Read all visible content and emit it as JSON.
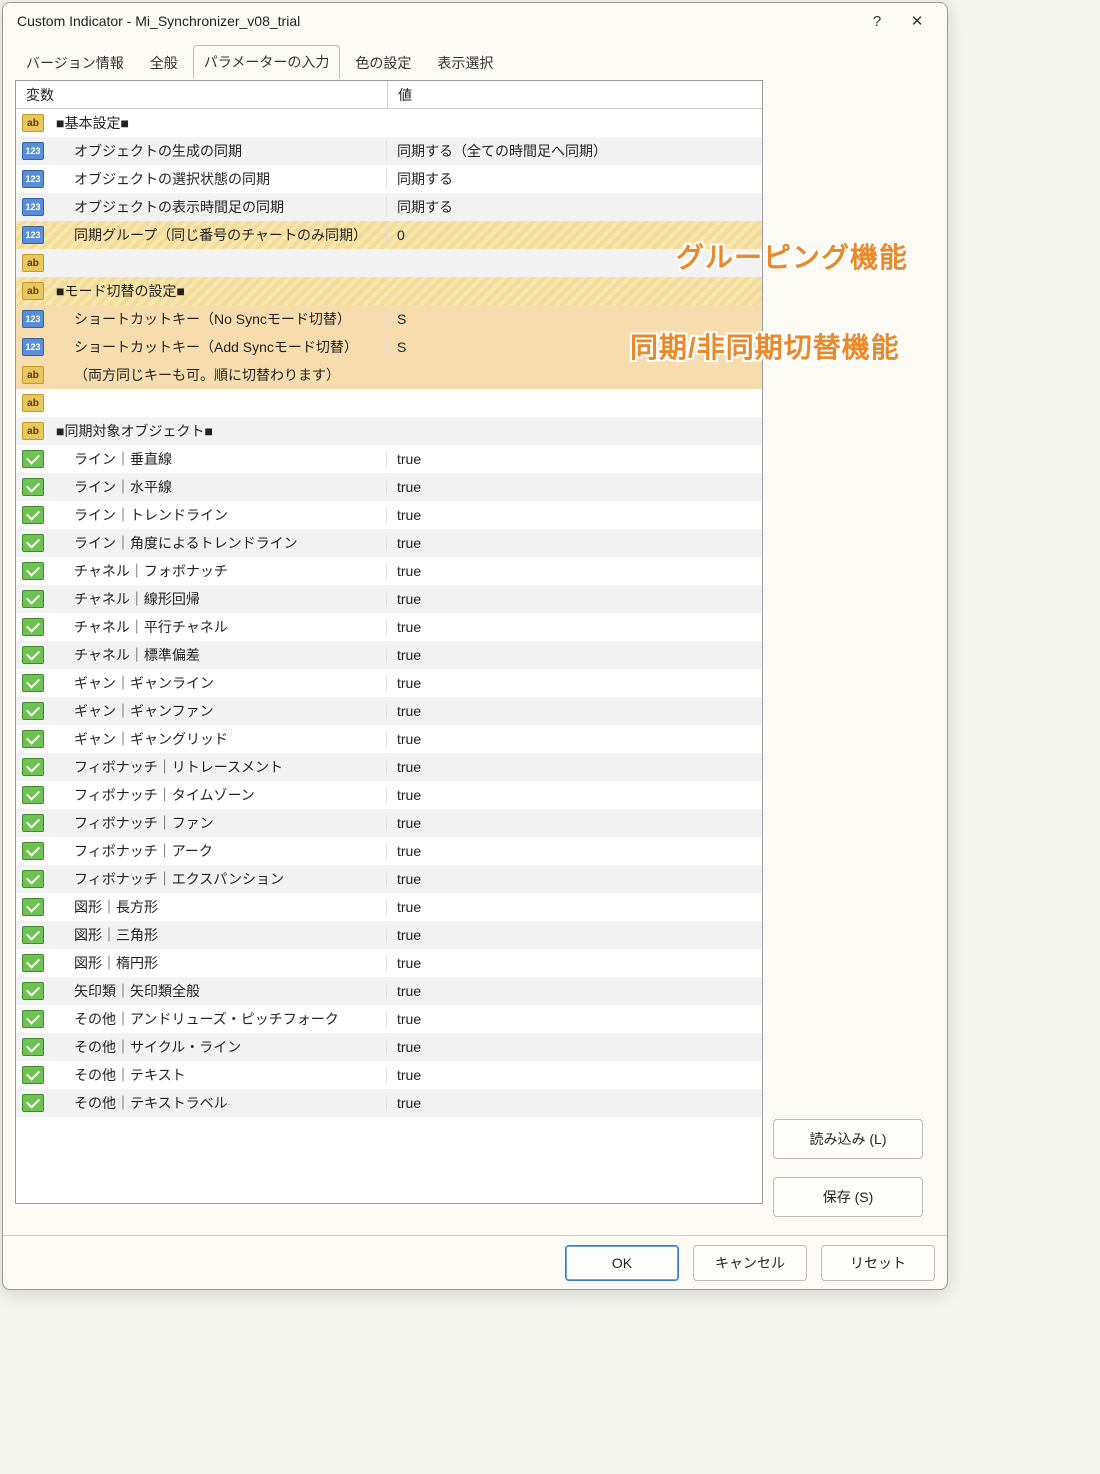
{
  "title": "Custom Indicator - Mi_Synchronizer_v08_trial",
  "help_icon": "?",
  "close_icon": "✕",
  "tabs": [
    "バージョン情報",
    "全般",
    "パラメーターの入力",
    "色の設定",
    "表示選択"
  ],
  "active_tab": 2,
  "columns": {
    "var": "変数",
    "val": "値"
  },
  "rows": [
    {
      "icon": "ab",
      "var": "■基本設定■",
      "val": "",
      "cls": ""
    },
    {
      "icon": "123",
      "var": "オブジェクトの生成の同期",
      "val": "同期する（全ての時間足へ同期）",
      "cls": "indent"
    },
    {
      "icon": "123",
      "var": "オブジェクトの選択状態の同期",
      "val": "同期する",
      "cls": "indent"
    },
    {
      "icon": "123",
      "var": "オブジェクトの表示時間足の同期",
      "val": "同期する",
      "cls": "indent"
    },
    {
      "icon": "123",
      "var": "同期グループ（同じ番号のチャートのみ同期）",
      "val": "0",
      "cls": "hl-yellow indent"
    },
    {
      "icon": "ab",
      "var": "",
      "val": "",
      "cls": ""
    },
    {
      "icon": "ab",
      "var": "■モード切替の設定■",
      "val": "",
      "cls": "hl-yellow"
    },
    {
      "icon": "123",
      "var": "ショートカットキー（No Syncモード切替）",
      "val": "S",
      "cls": "hl-orange indent"
    },
    {
      "icon": "123",
      "var": "ショートカットキー（Add Syncモード切替）",
      "val": "S",
      "cls": "hl-orange indent"
    },
    {
      "icon": "ab",
      "var": "（両方同じキーも可。順に切替わります）",
      "val": "",
      "cls": "hl-orange indent"
    },
    {
      "icon": "ab",
      "var": "",
      "val": "",
      "cls": ""
    },
    {
      "icon": "ab",
      "var": "■同期対象オブジェクト■",
      "val": "",
      "cls": ""
    },
    {
      "icon": "bool",
      "var": "ライン｜垂直線",
      "val": "true",
      "cls": "indent"
    },
    {
      "icon": "bool",
      "var": "ライン｜水平線",
      "val": "true",
      "cls": "indent"
    },
    {
      "icon": "bool",
      "var": "ライン｜トレンドライン",
      "val": "true",
      "cls": "indent"
    },
    {
      "icon": "bool",
      "var": "ライン｜角度によるトレンドライン",
      "val": "true",
      "cls": "indent"
    },
    {
      "icon": "bool",
      "var": "チャネル｜フォボナッチ",
      "val": "true",
      "cls": "indent"
    },
    {
      "icon": "bool",
      "var": "チャネル｜線形回帰",
      "val": "true",
      "cls": "indent"
    },
    {
      "icon": "bool",
      "var": "チャネル｜平行チャネル",
      "val": "true",
      "cls": "indent"
    },
    {
      "icon": "bool",
      "var": "チャネル｜標準偏差",
      "val": "true",
      "cls": "indent"
    },
    {
      "icon": "bool",
      "var": "ギャン｜ギャンライン",
      "val": "true",
      "cls": "indent"
    },
    {
      "icon": "bool",
      "var": "ギャン｜ギャンファン",
      "val": "true",
      "cls": "indent"
    },
    {
      "icon": "bool",
      "var": "ギャン｜ギャングリッド",
      "val": "true",
      "cls": "indent"
    },
    {
      "icon": "bool",
      "var": "フィボナッチ｜リトレースメント",
      "val": "true",
      "cls": "indent"
    },
    {
      "icon": "bool",
      "var": "フィボナッチ｜タイムゾーン",
      "val": "true",
      "cls": "indent"
    },
    {
      "icon": "bool",
      "var": "フィボナッチ｜ファン",
      "val": "true",
      "cls": "indent"
    },
    {
      "icon": "bool",
      "var": "フィボナッチ｜アーク",
      "val": "true",
      "cls": "indent"
    },
    {
      "icon": "bool",
      "var": "フィボナッチ｜エクスパンション",
      "val": "true",
      "cls": "indent"
    },
    {
      "icon": "bool",
      "var": "図形｜長方形",
      "val": "true",
      "cls": "indent"
    },
    {
      "icon": "bool",
      "var": "図形｜三角形",
      "val": "true",
      "cls": "indent"
    },
    {
      "icon": "bool",
      "var": "図形｜楕円形",
      "val": "true",
      "cls": "indent"
    },
    {
      "icon": "bool",
      "var": "矢印類｜矢印類全般",
      "val": "true",
      "cls": "indent"
    },
    {
      "icon": "bool",
      "var": "その他｜アンドリューズ・ピッチフォーク",
      "val": "true",
      "cls": "indent"
    },
    {
      "icon": "bool",
      "var": "その他｜サイクル・ライン",
      "val": "true",
      "cls": "indent"
    },
    {
      "icon": "bool",
      "var": "その他｜テキスト",
      "val": "true",
      "cls": "indent"
    },
    {
      "icon": "bool",
      "var": "その他｜テキストラベル",
      "val": "true",
      "cls": "indent"
    }
  ],
  "side_buttons": {
    "load": "読み込み (L)",
    "save": "保存 (S)"
  },
  "footer": {
    "ok": "OK",
    "cancel": "キャンセル",
    "reset": "リセット"
  },
  "annotations": {
    "grouping": "グルーピング機能",
    "sync_toggle": "同期/非同期切替機能"
  }
}
